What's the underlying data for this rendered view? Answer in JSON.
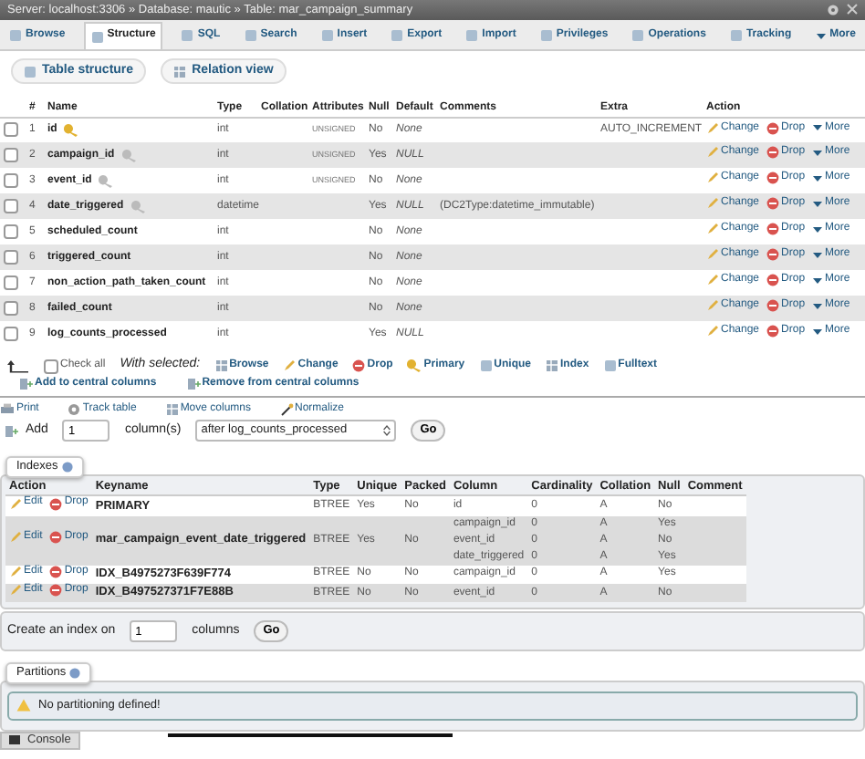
{
  "breadcrumb": "Server: localhost:3306 » Database: mautic » Table: mar_campaign_summary",
  "tabs": [
    {
      "label": "Browse",
      "selected": false,
      "kind": "tab"
    },
    {
      "label": "Structure",
      "selected": true,
      "kind": "tab"
    },
    {
      "label": "SQL",
      "selected": false,
      "kind": "tab"
    },
    {
      "label": "Search",
      "selected": false,
      "kind": "tab"
    },
    {
      "label": "Insert",
      "selected": false,
      "kind": "tab"
    },
    {
      "label": "Export",
      "selected": false,
      "kind": "tab"
    },
    {
      "label": "Import",
      "selected": false,
      "kind": "tab"
    },
    {
      "label": "Privileges",
      "selected": false,
      "kind": "tab"
    },
    {
      "label": "Operations",
      "selected": false,
      "kind": "tab"
    },
    {
      "label": "Tracking",
      "selected": false,
      "kind": "tab"
    },
    {
      "label": "More",
      "selected": false,
      "kind": "dropdown"
    }
  ],
  "subtabs": [
    {
      "label": "Table structure"
    },
    {
      "label": "Relation view"
    }
  ],
  "structure": {
    "columns": [
      "#",
      "Name",
      "Type",
      "Collation",
      "Attributes",
      "Null",
      "Default",
      "Comments",
      "Extra",
      "Action"
    ],
    "rows": [
      {
        "checked": false,
        "num": "1",
        "name": "id",
        "kind": "primary_key",
        "type": "int",
        "attributes": "UNSIGNED",
        "null": "No",
        "default": "None",
        "comments": "",
        "extra": "AUTO_INCREMENT",
        "actions": [
          "Change",
          "Drop",
          "More"
        ]
      },
      {
        "checked": false,
        "num": "2",
        "name": "campaign_id",
        "kind": "index_key",
        "type": "int",
        "attributes": "UNSIGNED",
        "null": "Yes",
        "default": "NULL",
        "comments": "",
        "extra": "",
        "actions": [
          "Change",
          "Drop",
          "More"
        ]
      },
      {
        "checked": false,
        "num": "3",
        "name": "event_id",
        "kind": "index_key",
        "type": "int",
        "attributes": "UNSIGNED",
        "null": "No",
        "default": "None",
        "comments": "",
        "extra": "",
        "actions": [
          "Change",
          "Drop",
          "More"
        ]
      },
      {
        "checked": false,
        "num": "4",
        "name": "date_triggered",
        "kind": "index_key",
        "type": "datetime",
        "attributes": "",
        "null": "Yes",
        "default": "NULL",
        "comments": "(DC2Type:datetime_immutable)",
        "extra": "",
        "actions": [
          "Change",
          "Drop",
          "More"
        ]
      },
      {
        "checked": false,
        "num": "5",
        "name": "scheduled_count",
        "type": "int",
        "attributes": "",
        "null": "No",
        "default": "None",
        "comments": "",
        "extra": "",
        "actions": [
          "Change",
          "Drop",
          "More"
        ]
      },
      {
        "checked": false,
        "num": "6",
        "name": "triggered_count",
        "type": "int",
        "attributes": "",
        "null": "No",
        "default": "None",
        "comments": "",
        "extra": "",
        "actions": [
          "Change",
          "Drop",
          "More"
        ]
      },
      {
        "checked": false,
        "num": "7",
        "name": "non_action_path_taken_count",
        "type": "int",
        "attributes": "",
        "null": "No",
        "default": "None",
        "comments": "",
        "extra": "",
        "actions": [
          "Change",
          "Drop",
          "More"
        ]
      },
      {
        "checked": false,
        "num": "8",
        "name": "failed_count",
        "type": "int",
        "attributes": "",
        "null": "No",
        "default": "None",
        "comments": "",
        "extra": "",
        "actions": [
          "Change",
          "Drop",
          "More"
        ]
      },
      {
        "checked": false,
        "num": "9",
        "name": "log_counts_processed",
        "type": "int",
        "attributes": "",
        "null": "Yes",
        "default": "NULL",
        "comments": "",
        "extra": "",
        "actions": [
          "Change",
          "Drop",
          "More"
        ]
      }
    ]
  },
  "bulk": {
    "check_all": {
      "label": "Check all",
      "checked": false
    },
    "with_selected": "With selected:",
    "actions": [
      "Browse",
      "Change",
      "Drop",
      "Primary",
      "Unique",
      "Index",
      "Fulltext"
    ],
    "central": [
      "Add to central columns",
      "Remove from central columns"
    ]
  },
  "tools": [
    "Print",
    "Track table",
    "Move columns",
    "Normalize"
  ],
  "add_columns": {
    "label": "Add",
    "value": "1",
    "unit": "column(s)",
    "position": "after log_counts_processed",
    "button": "Go"
  },
  "indexes": {
    "title": "Indexes",
    "columns": [
      "Action",
      "Keyname",
      "Type",
      "Unique",
      "Packed",
      "Column",
      "Cardinality",
      "Collation",
      "Null",
      "Comment"
    ],
    "rows": [
      {
        "actions": [
          "Edit",
          "Drop"
        ],
        "keyname": "PRIMARY",
        "type": "BTREE",
        "unique": "Yes",
        "packed": "No",
        "parts": [
          {
            "column": "id",
            "cardinality": "0",
            "collation": "A",
            "null": "No"
          }
        ]
      },
      {
        "actions": [
          "Edit",
          "Drop"
        ],
        "keyname": "mar_campaign_event_date_triggered",
        "type": "BTREE",
        "unique": "Yes",
        "packed": "No",
        "parts": [
          {
            "column": "campaign_id",
            "cardinality": "0",
            "collation": "A",
            "null": "Yes"
          },
          {
            "column": "event_id",
            "cardinality": "0",
            "collation": "A",
            "null": "No"
          },
          {
            "column": "date_triggered",
            "cardinality": "0",
            "collation": "A",
            "null": "Yes"
          }
        ]
      },
      {
        "actions": [
          "Edit",
          "Drop"
        ],
        "keyname": "IDX_B4975273F639F774",
        "type": "BTREE",
        "unique": "No",
        "packed": "No",
        "parts": [
          {
            "column": "campaign_id",
            "cardinality": "0",
            "collation": "A",
            "null": "Yes"
          }
        ]
      },
      {
        "actions": [
          "Edit",
          "Drop"
        ],
        "keyname": "IDX_B497527371F7E88B",
        "type": "BTREE",
        "unique": "No",
        "packed": "No",
        "parts": [
          {
            "column": "event_id",
            "cardinality": "0",
            "collation": "A",
            "null": "No"
          }
        ]
      }
    ],
    "create": {
      "label": "Create an index on",
      "value": "1",
      "unit": "columns",
      "button": "Go"
    }
  },
  "partitions": {
    "title": "Partitions",
    "message": "No partitioning defined!"
  },
  "console": "Console"
}
